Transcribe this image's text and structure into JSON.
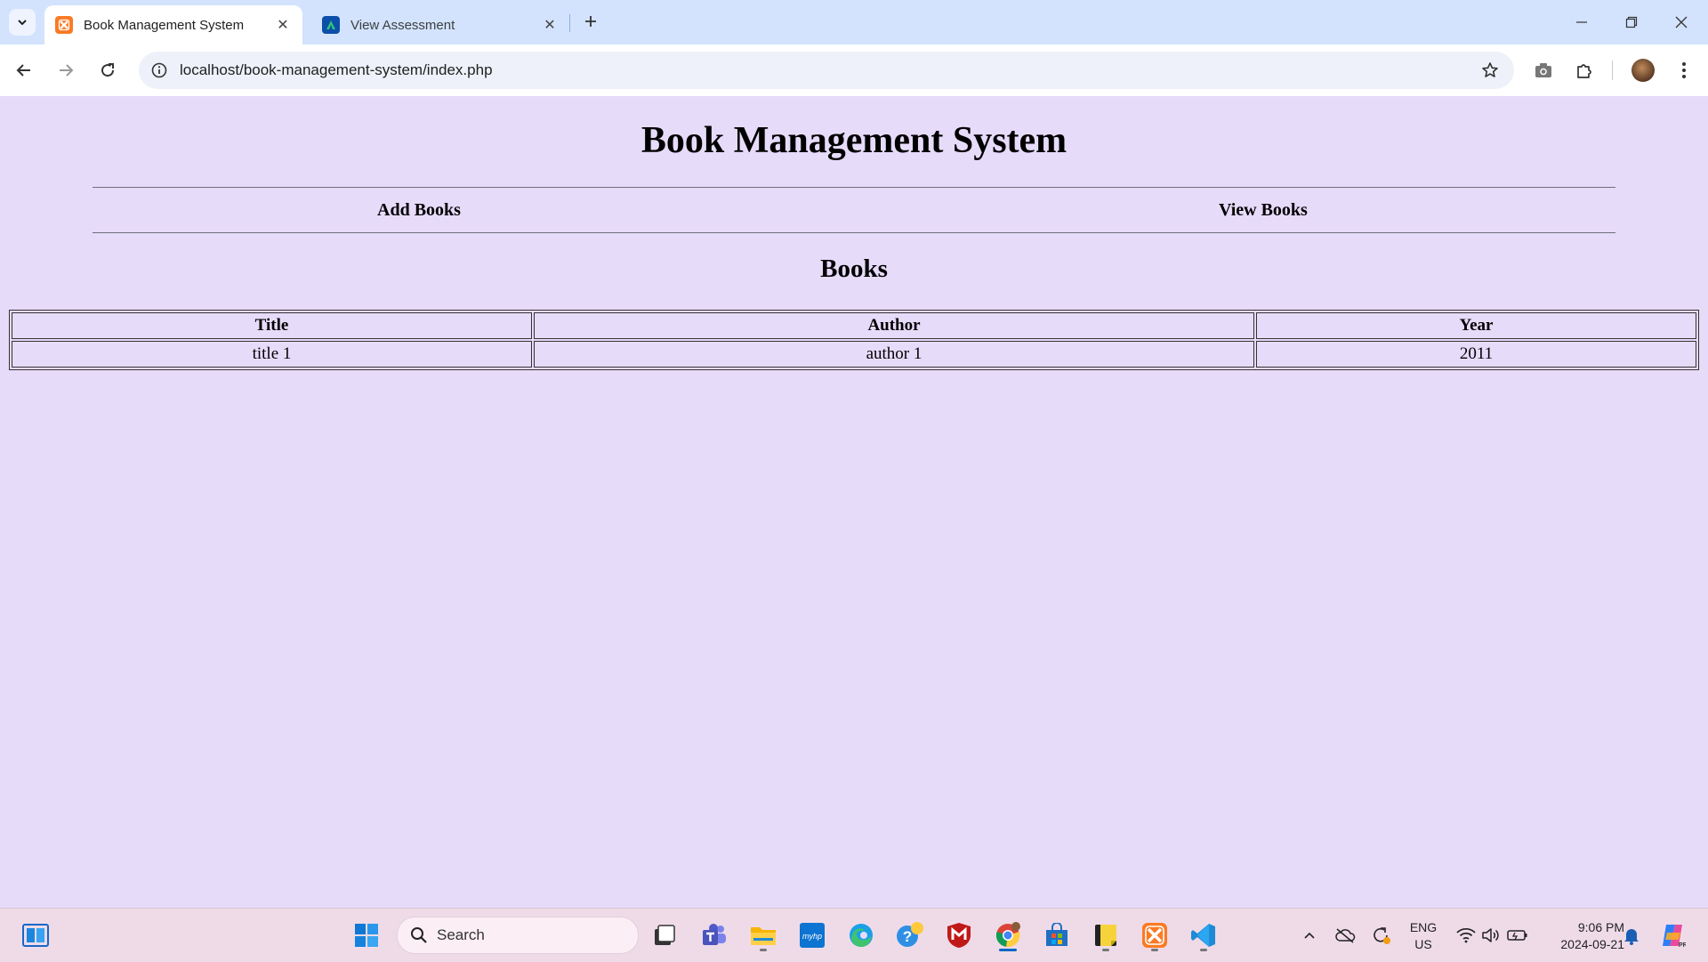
{
  "browser": {
    "tabs": [
      {
        "title": "Book Management System",
        "active": true,
        "favicon": "xampp-icon"
      },
      {
        "title": "View Assessment",
        "active": false,
        "favicon": "assessment-site-icon"
      }
    ],
    "address": "localhost/book-management-system/index.php"
  },
  "page": {
    "heading": "Book Management System",
    "nav": {
      "add_books": "Add Books",
      "view_books": "View Books"
    },
    "section_title": "Books",
    "table": {
      "headers": [
        "Title",
        "Author",
        "Year"
      ],
      "rows": [
        [
          "title 1",
          "author 1",
          "2011"
        ]
      ]
    }
  },
  "taskbar": {
    "search_label": "Search",
    "language": "ENG",
    "region": "US",
    "time": "9:06 PM",
    "date": "2024-09-21"
  },
  "colors": {
    "page_background": "#e7dbfa",
    "tabbar_background": "#d3e3fd",
    "taskbar_background": "#efdbe8"
  }
}
